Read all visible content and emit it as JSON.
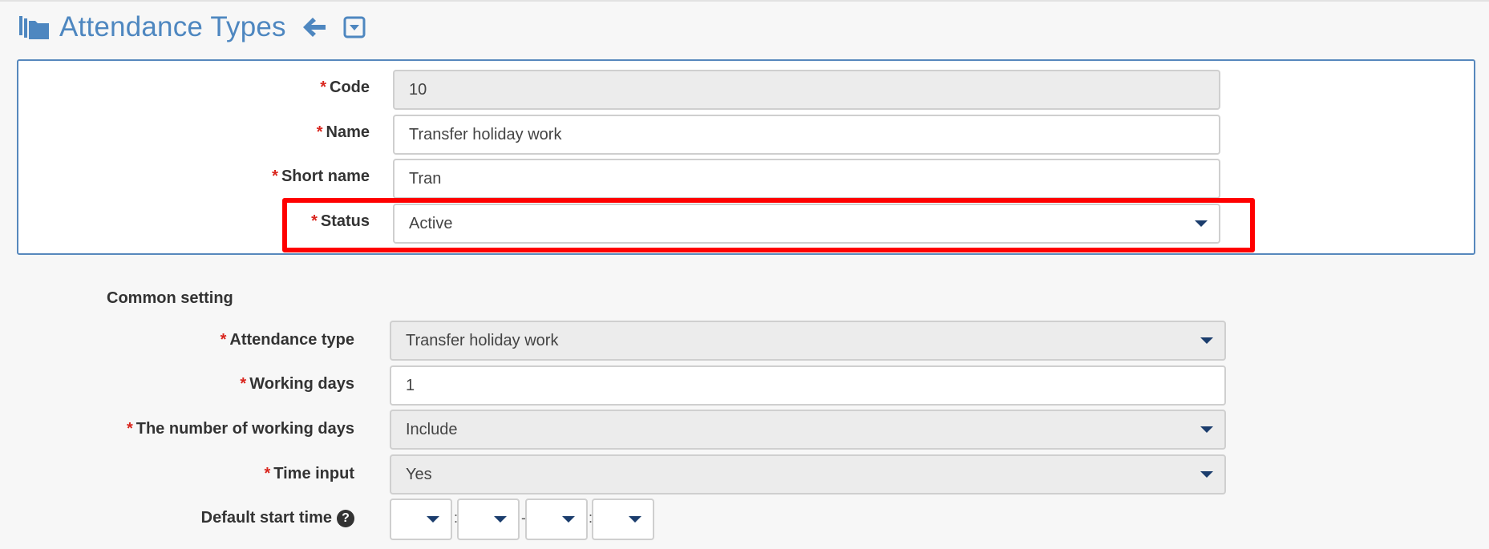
{
  "header": {
    "title": "Attendance Types",
    "icons": {
      "folder": "folder-stack-icon",
      "back": "arrow-left-icon",
      "collapse": "square-chevron-down-icon"
    }
  },
  "colors": {
    "title": "#4e87c0",
    "panel_border": "#5788bd",
    "required": "#d9251d",
    "highlight": "#ff0000",
    "caret": "#1b3d6d"
  },
  "form": {
    "code": {
      "label": "Code",
      "value": "10"
    },
    "name": {
      "label": "Name",
      "value": "Transfer holiday work"
    },
    "short_name": {
      "label": "Short name",
      "value": "Tran"
    },
    "status": {
      "label": "Status",
      "value": "Active"
    }
  },
  "common": {
    "title": "Common setting",
    "attendance_type": {
      "label": "Attendance type",
      "value": "Transfer holiday work"
    },
    "working_days": {
      "label": "Working days",
      "value": "1"
    },
    "number_of_working_days": {
      "label": "The number of working days",
      "value": "Include"
    },
    "time_input": {
      "label": "Time input",
      "value": "Yes"
    },
    "default_start_time": {
      "label": "Default start time",
      "separators": [
        ":",
        "-",
        ":"
      ]
    }
  },
  "required_mark": "*",
  "help_glyph": "?"
}
